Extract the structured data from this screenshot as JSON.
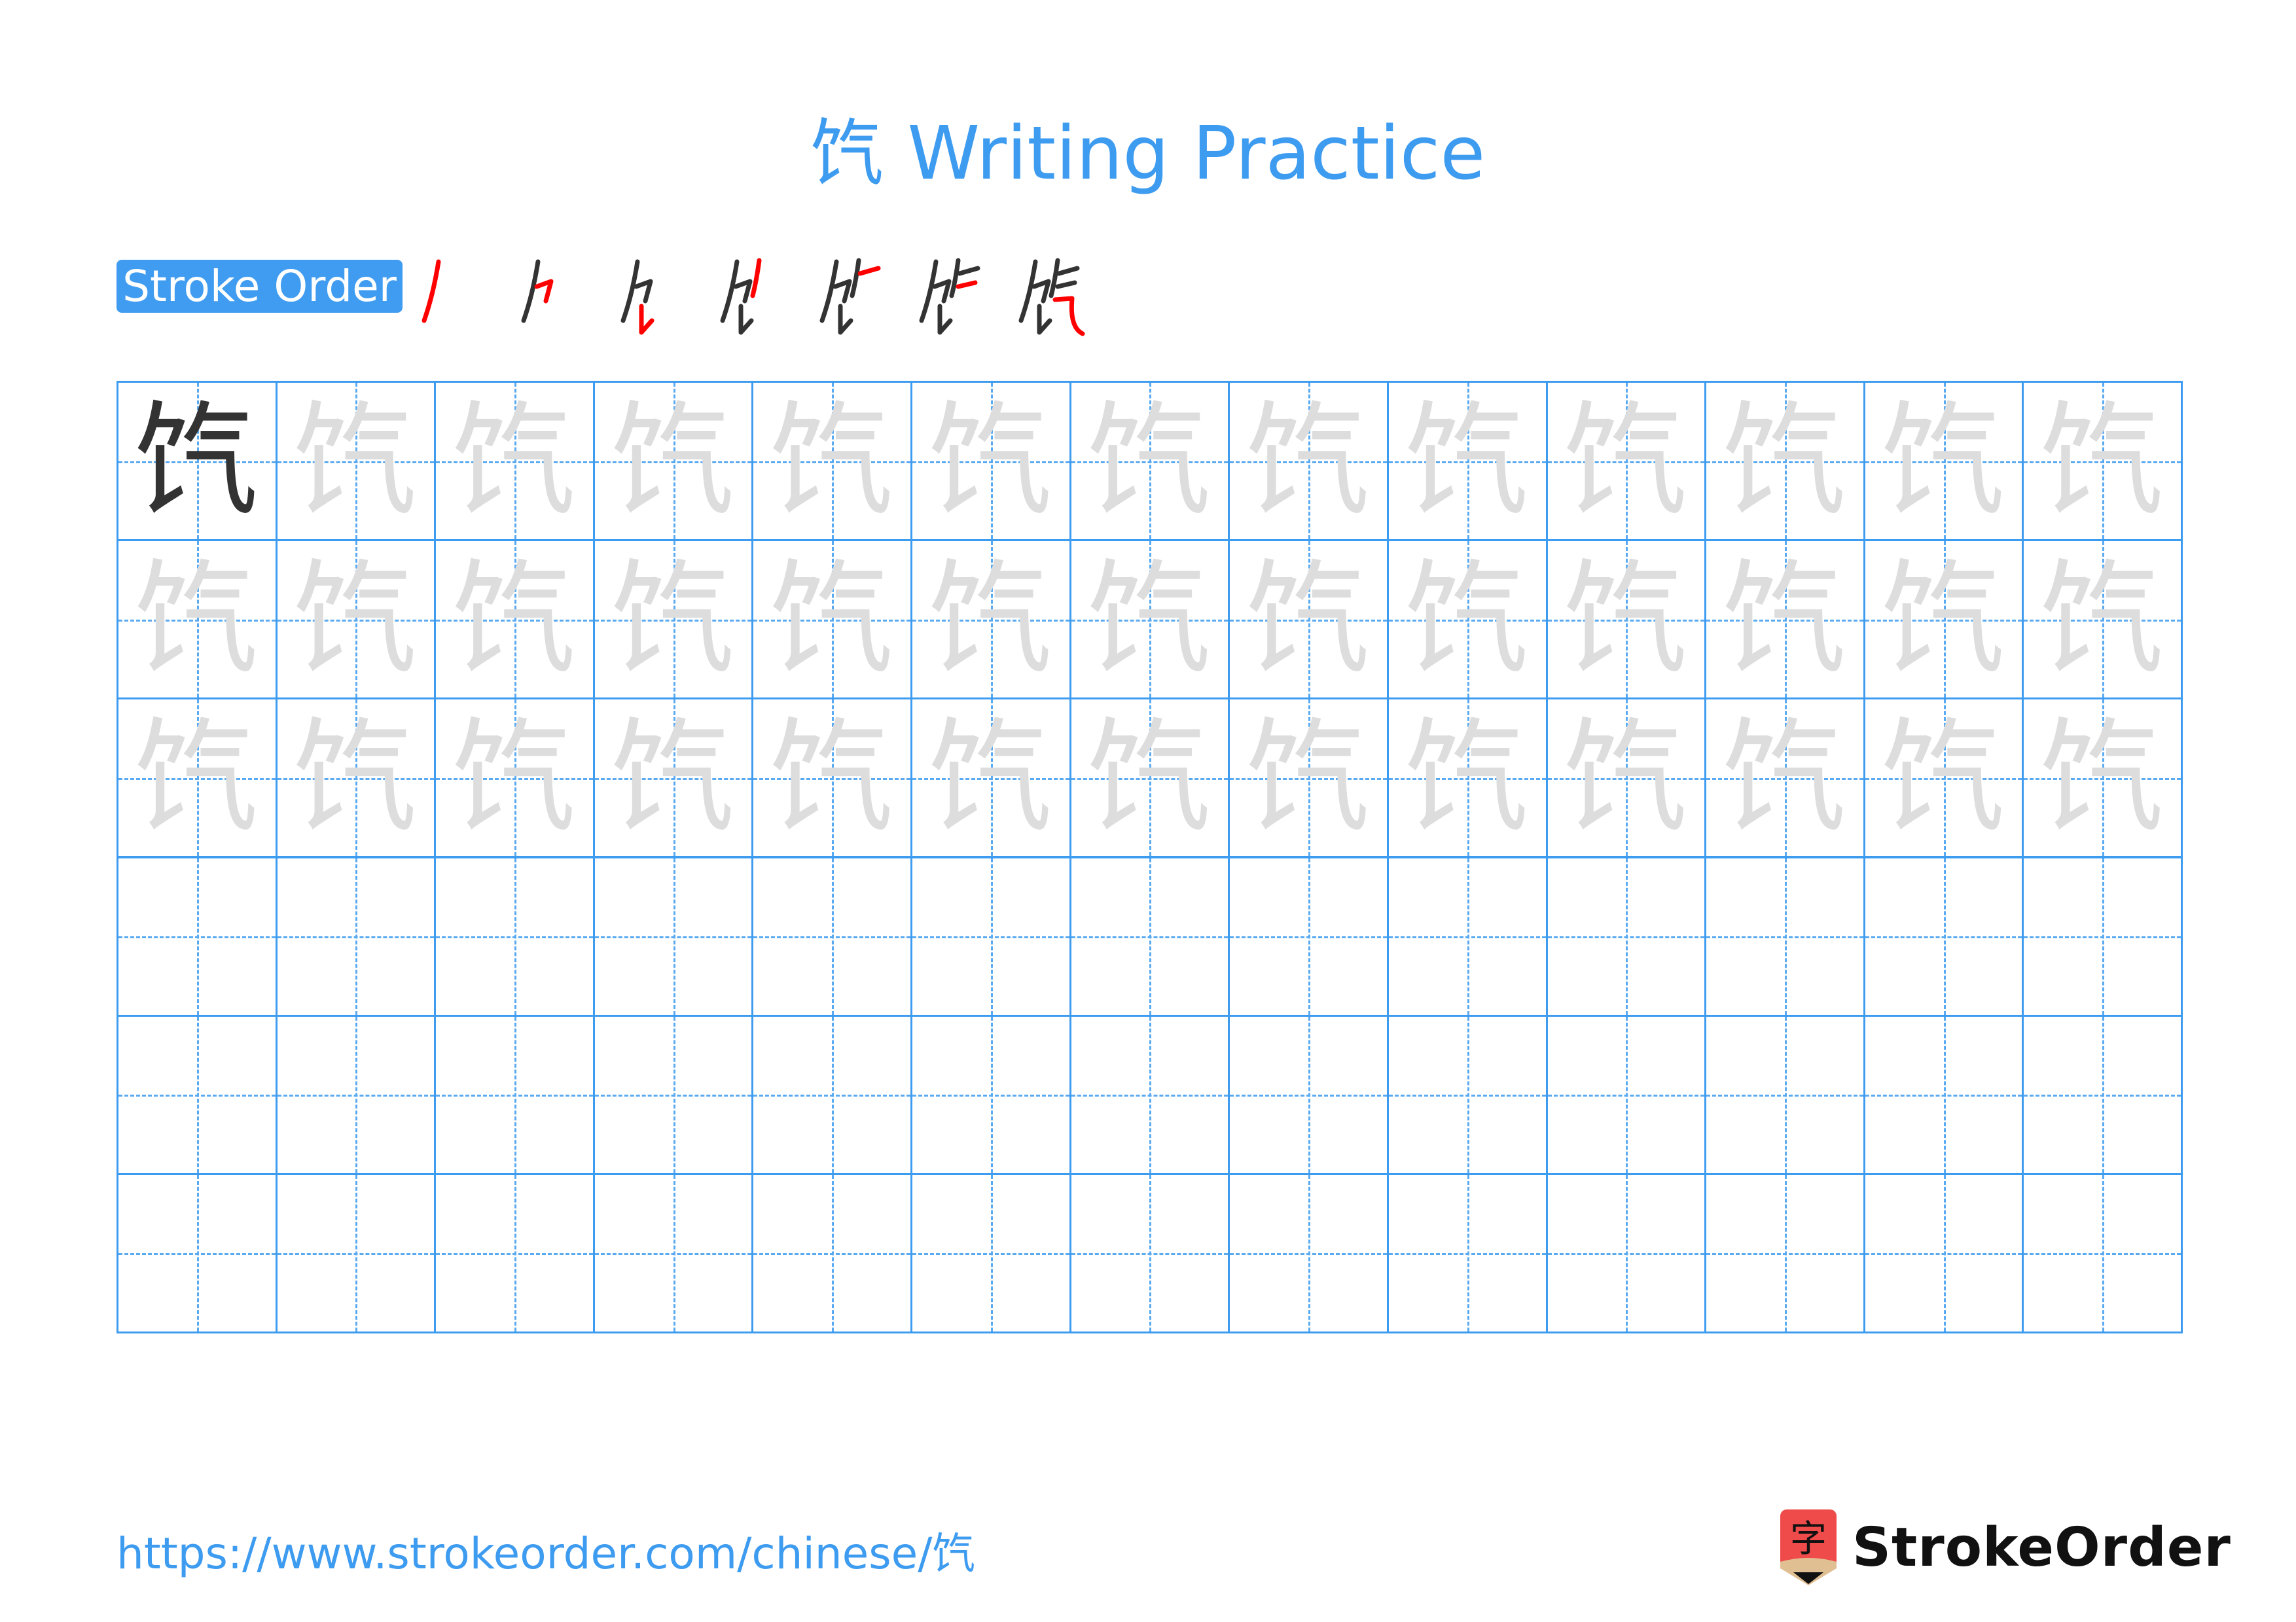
{
  "header": {
    "title": "饩 Writing Practice"
  },
  "character": "饩",
  "stroke_order": {
    "label": "Stroke Order",
    "step_count": 7,
    "colors": {
      "done": "#333333",
      "current": "#ff0000"
    }
  },
  "grid": {
    "rows": 6,
    "columns": 13,
    "solid_rows": 1,
    "solid_cells_in_first_row": 1,
    "trace_rows": 3,
    "empty_rows": 3,
    "line_color": "#3d9bf0",
    "trace_color": "#dddddd",
    "model_color": "#333333"
  },
  "footer": {
    "url": "https://www.strokeorder.com/chinese/饩",
    "logo_glyph": "字",
    "logo_text": "StrokeOrder"
  }
}
